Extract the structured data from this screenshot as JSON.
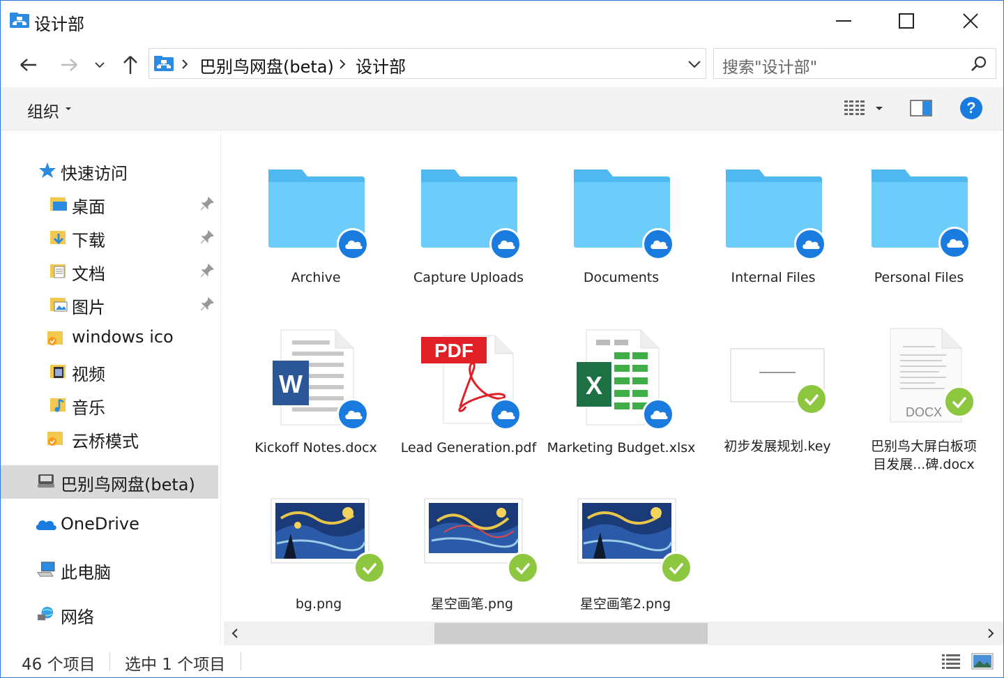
{
  "window": {
    "title": "设计部"
  },
  "nav": {
    "path": [
      "巴别鸟网盘(beta)",
      "设计部"
    ],
    "search_placeholder": "搜索\"设计部\""
  },
  "toolbar": {
    "organize_label": "组织"
  },
  "sidebar": {
    "quick_access": "快速访问",
    "items": [
      {
        "label": "桌面",
        "pinned": true
      },
      {
        "label": "下载",
        "pinned": true
      },
      {
        "label": "文档",
        "pinned": true
      },
      {
        "label": "图片",
        "pinned": true
      },
      {
        "label": "windows ico",
        "pinned": false
      },
      {
        "label": "视频",
        "pinned": false
      },
      {
        "label": "音乐",
        "pinned": false
      },
      {
        "label": "云桥模式",
        "pinned": false
      }
    ],
    "drive": "巴别鸟网盘(beta)",
    "onedrive": "OneDrive",
    "this_pc": "此电脑",
    "network": "网络"
  },
  "files": [
    {
      "name": "Archive",
      "kind": "folder",
      "sync": "cloud"
    },
    {
      "name": "Capture Uploads",
      "kind": "folder",
      "sync": "cloud"
    },
    {
      "name": "Documents",
      "kind": "folder",
      "sync": "cloud"
    },
    {
      "name": "Internal Files",
      "kind": "folder",
      "sync": "cloud"
    },
    {
      "name": "Personal Files",
      "kind": "folder",
      "sync": "cloud"
    },
    {
      "name": "Kickoff Notes.docx",
      "kind": "word",
      "sync": "cloud"
    },
    {
      "name": "Lead Generation.pdf",
      "kind": "pdf",
      "sync": "cloud"
    },
    {
      "name": "Marketing Budget.xlsx",
      "kind": "excel",
      "sync": "cloud"
    },
    {
      "name": "初步发展规划.key",
      "kind": "keynote",
      "sync": "check"
    },
    {
      "name": "巴别鸟大屏白板项目发展...碑.docx",
      "name_line1": "巴别鸟大屏白板项",
      "name_line2": "目发展...碑.docx",
      "kind": "docx-gray",
      "sync": "check",
      "doc_label": "DOCX"
    },
    {
      "name": "bg.png",
      "kind": "image",
      "sync": "check"
    },
    {
      "name": "星空画笔.png",
      "kind": "image",
      "sync": "check"
    },
    {
      "name": "星空画笔2.png",
      "kind": "image",
      "sync": "check"
    }
  ],
  "icons": {
    "pdf_label": "PDF",
    "word_letter": "W",
    "excel_letter": "X"
  },
  "status": {
    "total": "46 个项目",
    "selected": "选中 1 个项目"
  },
  "colors": {
    "folder": "#5ac8fa",
    "cloud_badge": "#1a7bdf",
    "check_badge": "#8dc63f",
    "help": "#1a7bdf"
  }
}
